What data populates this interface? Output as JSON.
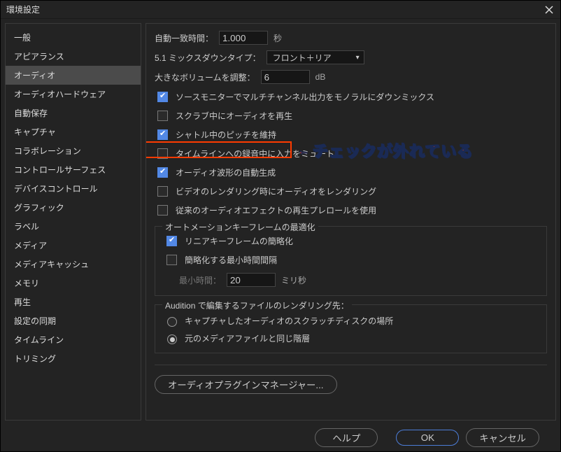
{
  "window": {
    "title": "環境設定"
  },
  "sidebar": {
    "items": [
      {
        "label": "一般"
      },
      {
        "label": "アピアランス"
      },
      {
        "label": "オーディオ"
      },
      {
        "label": "オーディオハードウェア"
      },
      {
        "label": "自動保存"
      },
      {
        "label": "キャプチャ"
      },
      {
        "label": "コラボレーション"
      },
      {
        "label": "コントロールサーフェス"
      },
      {
        "label": "デバイスコントロール"
      },
      {
        "label": "グラフィック"
      },
      {
        "label": "ラベル"
      },
      {
        "label": "メディア"
      },
      {
        "label": "メディアキャッシュ"
      },
      {
        "label": "メモリ"
      },
      {
        "label": "再生"
      },
      {
        "label": "設定の同期"
      },
      {
        "label": "タイムライン"
      },
      {
        "label": "トリミング"
      }
    ],
    "selected_label": "オーディオ"
  },
  "fields": {
    "auto_match_label": "自動一致時間：",
    "auto_match_value": "1.000",
    "auto_match_unit": "秒",
    "mixdown_label": "5.1 ミックスダウンタイプ：",
    "mixdown_value": "フロント＋リア",
    "large_vol_label": "大きなボリュームを調整：",
    "large_vol_value": "6",
    "large_vol_unit": "dB"
  },
  "checks": {
    "c1": "ソースモニターでマルチチャンネル出力をモノラルにダウンミックス",
    "c2": "スクラブ中にオーディオを再生",
    "c3": "シャトル中のピッチを維持",
    "c4": "タイムラインへの録音中に入力をミュート",
    "c5": "オーディオ波形の自動生成",
    "c6": "ビデオのレンダリング時にオーディオをレンダリング",
    "c7": "従来のオーディオエフェクトの再生プレロールを使用"
  },
  "check_states": {
    "c1": true,
    "c2": false,
    "c3": true,
    "c4": false,
    "c5": true,
    "c6": false,
    "c7": false
  },
  "automation": {
    "legend": "オートメーションキーフレームの最適化",
    "linear": "リニアキーフレームの簡略化",
    "linear_checked": true,
    "minint": "簡略化する最小時間間隔",
    "minint_checked": false,
    "mintime_label": "最小時間：",
    "mintime_value": "20",
    "mintime_unit": "ミリ秒"
  },
  "audition": {
    "legend": "Audition で編集するファイルのレンダリング先：",
    "r1": "キャプチャしたオーディオのスクラッチディスクの場所",
    "r2": "元のメディアファイルと同じ階層"
  },
  "radio_state": {
    "selected_index": 1
  },
  "buttons": {
    "plugin_mgr": "オーディオプラグインマネージャー...",
    "help": "ヘルプ",
    "ok": "OK",
    "cancel": "キャンセル"
  },
  "annotation": {
    "arrow": "←",
    "text": "チェックが外れている"
  }
}
